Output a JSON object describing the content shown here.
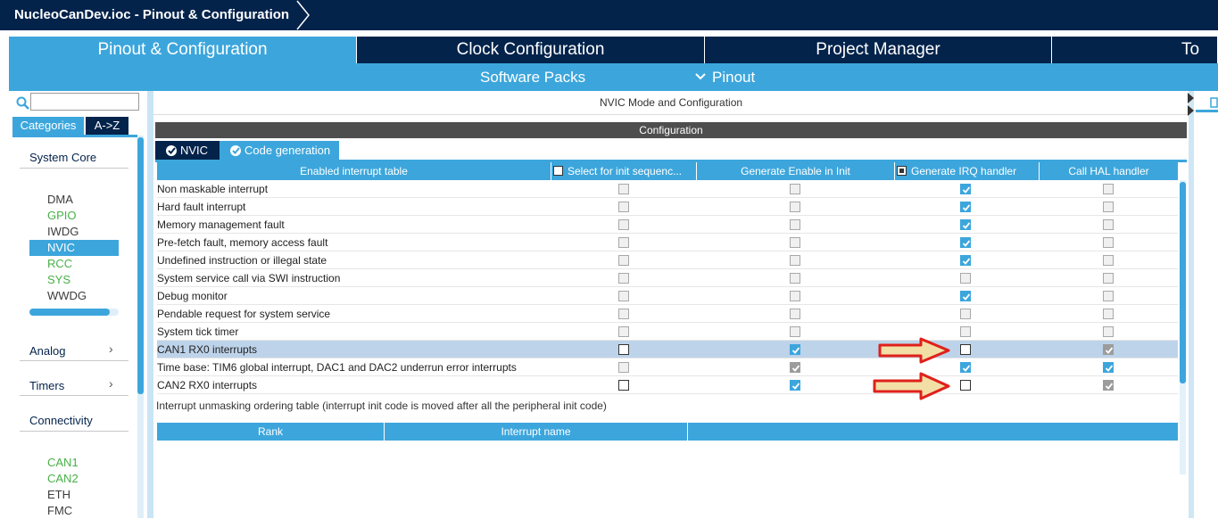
{
  "window": {
    "title": "NucleoCanDev.ioc - Pinout & Configuration"
  },
  "main_tabs": [
    {
      "label": "Pinout & Configuration",
      "active": true
    },
    {
      "label": "Clock Configuration",
      "active": false
    },
    {
      "label": "Project Manager",
      "active": false
    },
    {
      "label": "To",
      "active": false
    }
  ],
  "sub_menu": {
    "software_packs": "Software Packs",
    "pinout": "Pinout"
  },
  "left_panel": {
    "search_value": "",
    "category_tabs": [
      "Categories",
      "A->Z"
    ],
    "system_core": {
      "title": "System Core",
      "items": [
        {
          "label": "DMA",
          "color": "#3c3c3c"
        },
        {
          "label": "GPIO",
          "color": "#48b048"
        },
        {
          "label": "IWDG",
          "color": "#3c3c3c"
        },
        {
          "label": "NVIC",
          "color": "#ffffff",
          "selected": true
        },
        {
          "label": "RCC",
          "color": "#48b048"
        },
        {
          "label": "SYS",
          "color": "#48b048"
        },
        {
          "label": "WWDG",
          "color": "#3c3c3c"
        }
      ]
    },
    "analog": {
      "title": "Analog"
    },
    "timers": {
      "title": "Timers"
    },
    "connectivity": {
      "title": "Connectivity",
      "items": [
        {
          "label": "CAN1",
          "color": "#48b048"
        },
        {
          "label": "CAN2",
          "color": "#48b048"
        },
        {
          "label": "ETH",
          "color": "#3c3c3c"
        },
        {
          "label": "FMC",
          "color": "#3c3c3c"
        }
      ]
    }
  },
  "center": {
    "header": "NVIC Mode and Configuration",
    "config_bar": "Configuration",
    "subtabs": [
      "NVIC",
      "Code generation"
    ],
    "table": {
      "columns": [
        "Enabled interrupt table",
        "Select for init sequenc...",
        "Generate Enable in Init",
        "Generate IRQ handler",
        "Call HAL handler"
      ],
      "rows": [
        {
          "name": "Non maskable interrupt",
          "sel": "off",
          "gen_enable": "off",
          "gen_irq": "on",
          "call_hal": "off"
        },
        {
          "name": "Hard fault interrupt",
          "sel": "off",
          "gen_enable": "off",
          "gen_irq": "on",
          "call_hal": "off"
        },
        {
          "name": "Memory management fault",
          "sel": "off",
          "gen_enable": "off",
          "gen_irq": "on",
          "call_hal": "off"
        },
        {
          "name": "Pre-fetch fault, memory access fault",
          "sel": "off",
          "gen_enable": "off",
          "gen_irq": "on",
          "call_hal": "off"
        },
        {
          "name": "Undefined instruction or illegal state",
          "sel": "off",
          "gen_enable": "off",
          "gen_irq": "on",
          "call_hal": "off"
        },
        {
          "name": "System service call via SWI instruction",
          "sel": "off",
          "gen_enable": "off",
          "gen_irq": "off",
          "call_hal": "off"
        },
        {
          "name": "Debug monitor",
          "sel": "off",
          "gen_enable": "off",
          "gen_irq": "on",
          "call_hal": "off"
        },
        {
          "name": "Pendable request for system service",
          "sel": "off",
          "gen_enable": "off",
          "gen_irq": "off",
          "call_hal": "off"
        },
        {
          "name": "System tick timer",
          "sel": "off",
          "gen_enable": "off",
          "gen_irq": "off",
          "call_hal": "off"
        },
        {
          "name": "CAN1 RX0 interrupts",
          "sel": "empty",
          "gen_enable": "on",
          "gen_irq": "empty",
          "call_hal": "grey",
          "selected": true
        },
        {
          "name": "Time base: TIM6 global interrupt, DAC1 and DAC2 underrun error interrupts",
          "sel": "off",
          "gen_enable": "grey",
          "gen_irq": "on",
          "call_hal": "on"
        },
        {
          "name": "CAN2 RX0 interrupts",
          "sel": "empty",
          "gen_enable": "on",
          "gen_irq": "empty",
          "call_hal": "grey"
        }
      ]
    },
    "unmask_label": "Interrupt unmasking ordering table (interrupt init code is moved after all the peripheral init code)",
    "unmask_columns": [
      "Rank",
      "Interrupt name"
    ]
  },
  "colors": {
    "accent": "#3ca6dc",
    "navy": "#03234b",
    "arrow_red": "#e0201b",
    "arrow_fill": "#f2dfa6"
  },
  "icons": {
    "search": "search-icon",
    "check": "check-icon",
    "chevron": "chevron-right-icon",
    "pinout_chevron": "chevron-down-icon"
  }
}
